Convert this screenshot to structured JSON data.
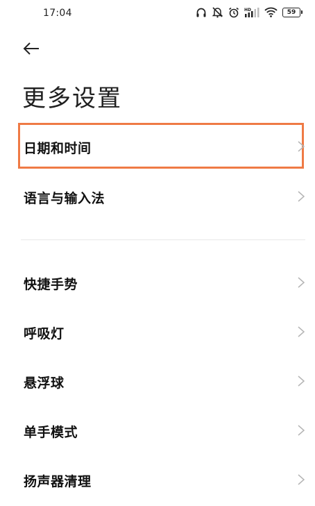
{
  "status_bar": {
    "time": "17:04",
    "icons": [
      "headset-icon",
      "mute-off-icon",
      "alarm-icon",
      "hd-signal-icon",
      "wifi-icon",
      "battery-icon"
    ],
    "hd_label": "HD",
    "battery_level": "59"
  },
  "header": {
    "back_icon": "arrow-left-icon",
    "title": "更多设置"
  },
  "settings": {
    "group1": [
      {
        "label": "日期和时间",
        "highlighted": true
      },
      {
        "label": "语言与输入法"
      }
    ],
    "group2": [
      {
        "label": "快捷手势"
      },
      {
        "label": "呼吸灯"
      },
      {
        "label": "悬浮球"
      },
      {
        "label": "单手模式"
      },
      {
        "label": "扬声器清理"
      }
    ]
  },
  "colors": {
    "highlight_border": "#ef7a45",
    "chevron": "#b5b5b5",
    "text": "#111111"
  }
}
